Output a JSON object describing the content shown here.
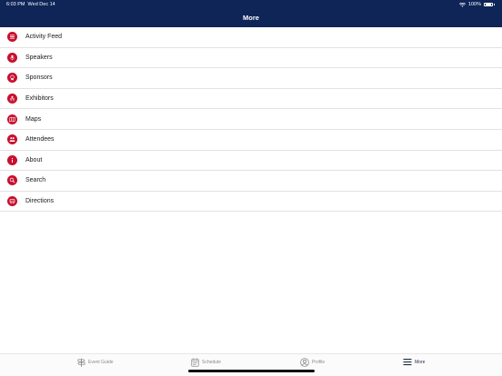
{
  "status_bar": {
    "time": "6:03 PM",
    "date": "Wed Dec 14",
    "battery": "100%"
  },
  "header": {
    "title": "More"
  },
  "menu": {
    "items": [
      {
        "label": "Activity Feed",
        "icon": "activity-feed-icon"
      },
      {
        "label": "Speakers",
        "icon": "speakers-icon"
      },
      {
        "label": "Sponsors",
        "icon": "sponsors-icon"
      },
      {
        "label": "Exhibitors",
        "icon": "exhibitors-icon"
      },
      {
        "label": "Maps",
        "icon": "maps-icon"
      },
      {
        "label": "Attendees",
        "icon": "attendees-icon"
      },
      {
        "label": "About",
        "icon": "info-icon"
      },
      {
        "label": "Search",
        "icon": "search-icon"
      },
      {
        "label": "Directions",
        "icon": "directions-icon"
      }
    ]
  },
  "tabbar": {
    "tabs": [
      {
        "label": "Event Guide",
        "icon": "signpost-icon"
      },
      {
        "label": "Schedule",
        "icon": "calendar-icon"
      },
      {
        "label": "Profile",
        "icon": "user-circle-icon"
      },
      {
        "label": "More",
        "icon": "hamburger-menu-icon"
      }
    ],
    "active": "More"
  },
  "colors": {
    "header_bg": "#0f2558",
    "accent": "#c8102e"
  }
}
